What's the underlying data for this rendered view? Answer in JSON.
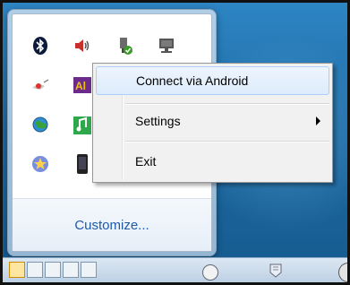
{
  "context_menu": {
    "items": [
      {
        "label": "Connect via Android"
      },
      {
        "label": "Settings"
      },
      {
        "label": "Exit"
      }
    ]
  },
  "tray": {
    "customize_label": "Customize...",
    "icons": [
      "bluetooth-icon",
      "speaker-icon",
      "usb-device-icon",
      "network-icon",
      "satellite-icon",
      "app-icon",
      "",
      "",
      "globe-icon",
      "music-icon",
      "",
      "",
      "star-icon",
      "phone-icon",
      "",
      ""
    ]
  },
  "colors": {
    "link": "#1e5aa8",
    "menu_highlight": "#dcebfc",
    "desktop": "#1d6aa3"
  }
}
